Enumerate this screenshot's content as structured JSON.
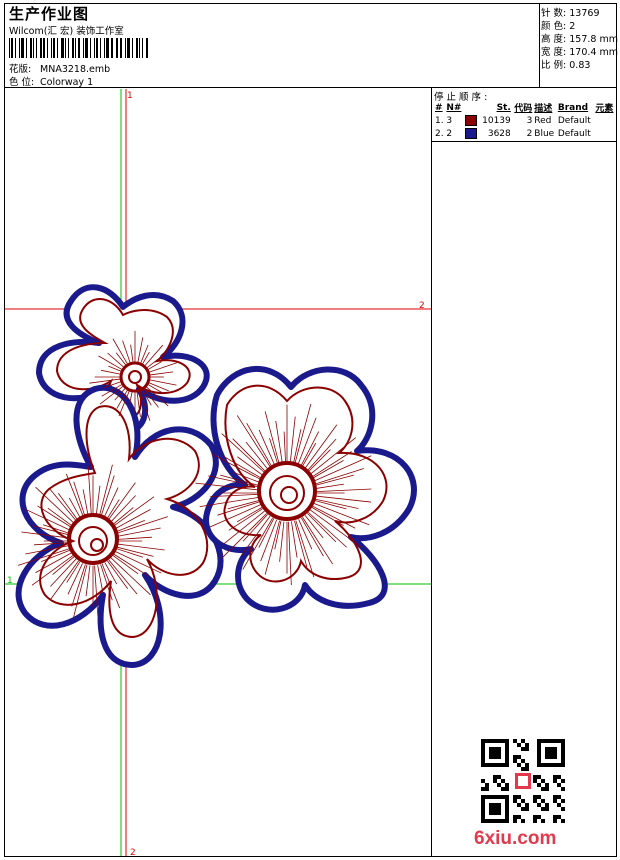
{
  "header": {
    "title": "生产作业图",
    "company": "Wilcom(汇 宏) 装饰工作室",
    "design_label": "花版:",
    "design_value": "MNA3218.emb",
    "colorway_label": "色 位:",
    "colorway_value": "Colorway 1"
  },
  "stats": [
    {
      "label": "针 数:",
      "value": "13769"
    },
    {
      "label": "颜 色:",
      "value": "2"
    },
    {
      "label": "高 度:",
      "value": "157.8 mm"
    },
    {
      "label": "宽 度:",
      "value": "170.4 mm"
    },
    {
      "label": "比 例:",
      "value": "0.83"
    }
  ],
  "stops": {
    "title": "停 止 顺 序 :",
    "columns": [
      "#",
      "N#",
      "St.",
      "代码",
      "描述",
      "Brand",
      "元素"
    ],
    "rows": [
      {
        "idx": "1.",
        "n": "3",
        "color": "#8b0000",
        "st": "10139",
        "code": "3",
        "desc": "Red",
        "brand": "Default"
      },
      {
        "idx": "2.",
        "n": "2",
        "color": "#1a1a8c",
        "st": "3628",
        "code": "2",
        "desc": "Blue",
        "brand": "Default"
      }
    ]
  },
  "markers": {
    "top": "1",
    "right": "2",
    "bottom": "2",
    "left": "1"
  },
  "watermark": "6xiu.com",
  "colors": {
    "red_thread": "#8b0000",
    "blue_thread": "#1a1a8c",
    "guide_red": "#e00000",
    "guide_green": "#00c000"
  }
}
